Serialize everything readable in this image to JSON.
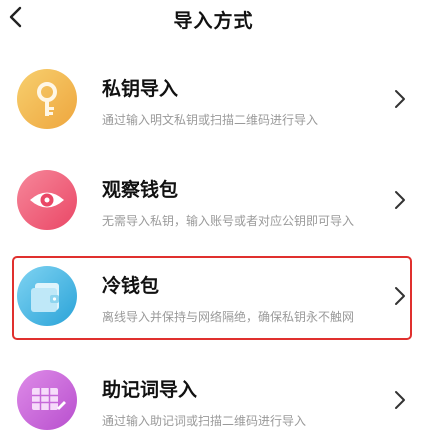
{
  "header": {
    "title": "导入方式"
  },
  "options": [
    {
      "title": "私钥导入",
      "description": "通过输入明文私钥或扫描二维码进行导入",
      "icon": "key-icon",
      "color": "#f2b650"
    },
    {
      "title": "观察钱包",
      "description": "无需导入私钥，输入账号或者对应公钥即可导入",
      "icon": "eye-icon",
      "color": "#ee5b78"
    },
    {
      "title": "冷钱包",
      "description": "离线导入并保持与网络隔绝，确保私钥永不触网",
      "icon": "cold-wallet-icon",
      "color": "#35aee0",
      "highlighted": true,
      "highlight_color": "#e0302e"
    },
    {
      "title": "助记词导入",
      "description": "通过输入助记词或扫描二维码进行导入",
      "icon": "mnemonic-grid-icon",
      "color": "#c75fd6"
    }
  ]
}
